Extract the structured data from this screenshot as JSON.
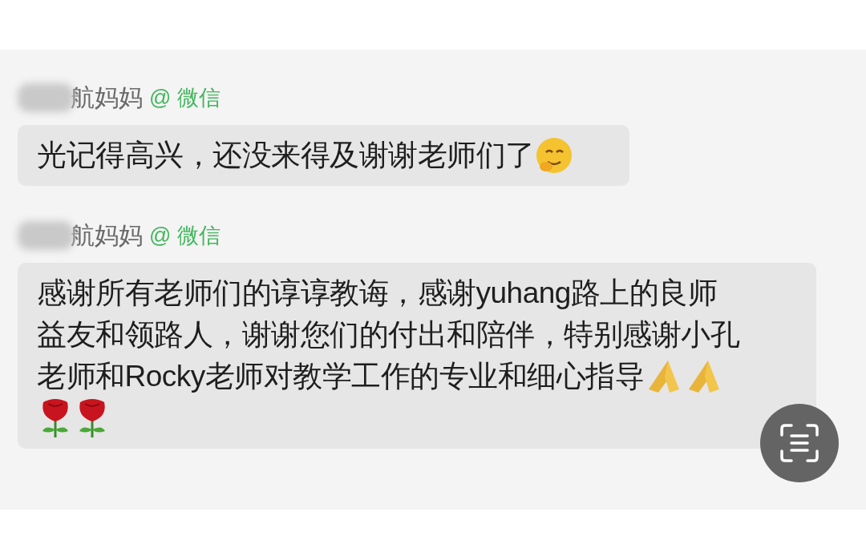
{
  "messages": [
    {
      "sender": "航妈妈",
      "source": "@ 微信",
      "lines": [
        {
          "text": "光记得高兴，还没来得及谢谢老师们了",
          "emojis": [
            {
              "kind": "smile"
            }
          ]
        }
      ]
    },
    {
      "sender": "航妈妈",
      "source": "@ 微信",
      "lines": [
        {
          "text": "感谢所有老师们的谆谆教诲，感谢yuhang路上的良师"
        },
        {
          "text": "益友和领路人，谢谢您们的付出和陪伴，特别感谢小孔"
        },
        {
          "text": "老师和Rocky老师对教学工作的专业和细心指导",
          "emojis": [
            {
              "kind": "pray"
            },
            {
              "kind": "pray"
            }
          ]
        },
        {
          "emojis": [
            {
              "kind": "rose"
            },
            {
              "kind": "rose"
            }
          ]
        }
      ]
    }
  ]
}
